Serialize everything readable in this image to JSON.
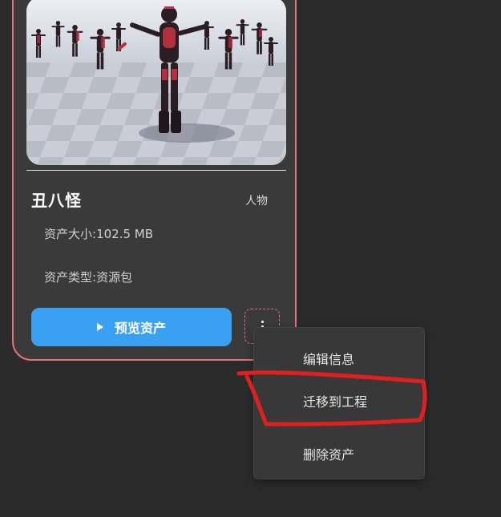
{
  "asset": {
    "name": "丑八怪",
    "category": "人物",
    "size_label": "资产大小:",
    "size_value": "102.5 MB",
    "type_label": "资产类型:",
    "type_value": "资源包"
  },
  "actions": {
    "preview_label": "预览资产"
  },
  "menu": {
    "items": [
      {
        "label": "编辑信息"
      },
      {
        "label": "迁移到工程"
      },
      {
        "label": "删除资产"
      }
    ]
  },
  "colors": {
    "card_border": "#e2737f",
    "preview_button": "#3aa1f2",
    "annotation": "#e02020",
    "background": "#2b2b2b"
  }
}
